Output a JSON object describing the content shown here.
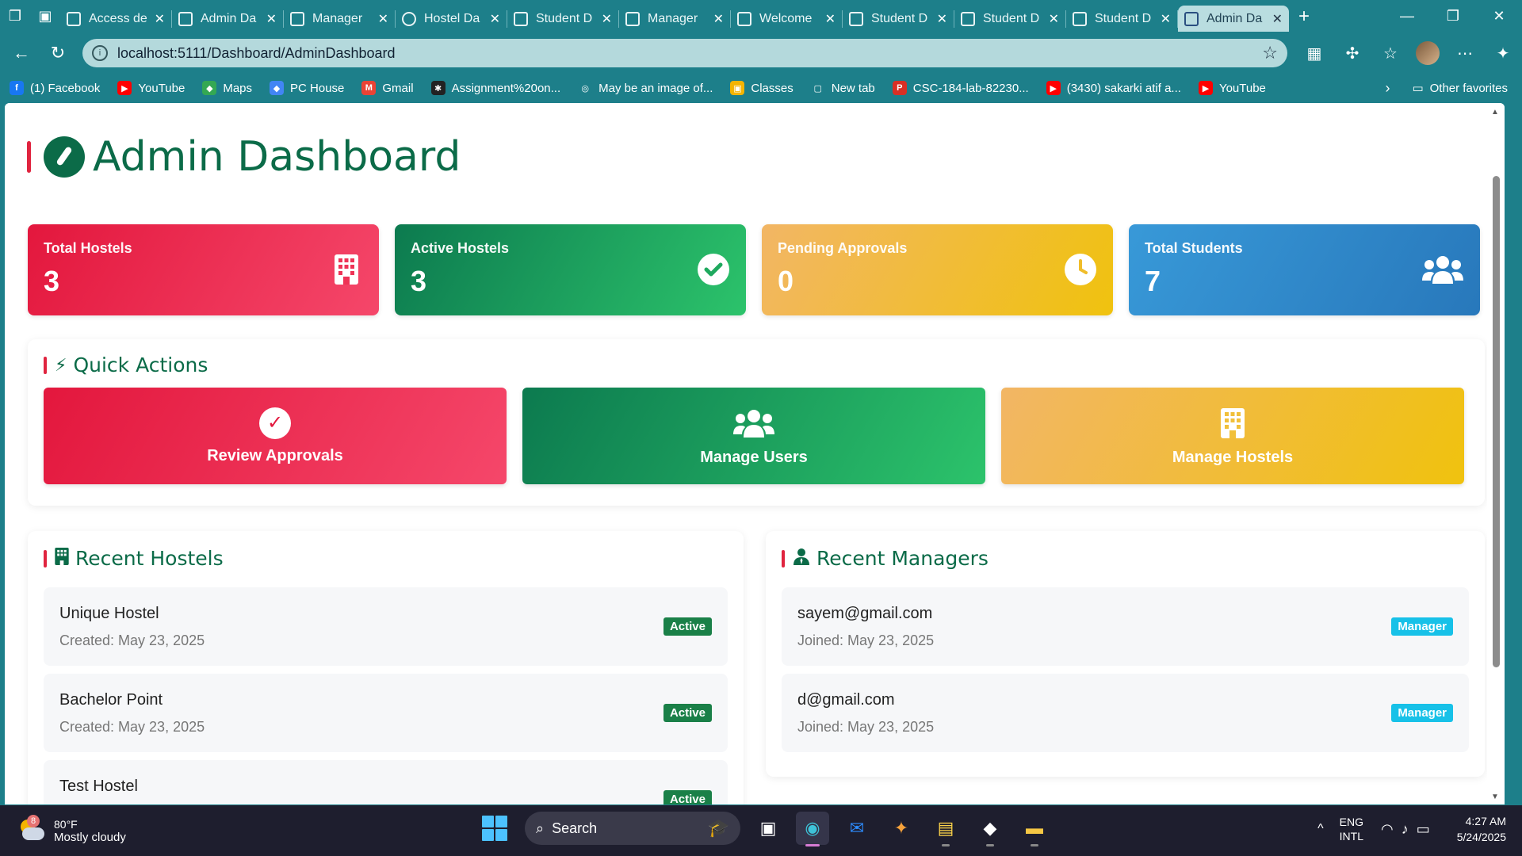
{
  "browser": {
    "tabs": [
      {
        "title": "Access de"
      },
      {
        "title": "Admin Da"
      },
      {
        "title": "Manager"
      },
      {
        "title": "Hostel Da"
      },
      {
        "title": "Student D"
      },
      {
        "title": "Manager"
      },
      {
        "title": "Welcome"
      },
      {
        "title": "Student D"
      },
      {
        "title": "Student D"
      },
      {
        "title": "Student D"
      },
      {
        "title": "Admin Da"
      }
    ],
    "url": "localhost:5111/Dashboard/AdminDashboard",
    "bookmarks": [
      {
        "label": "(1) Facebook",
        "color": "#1877f2",
        "glyph": "f"
      },
      {
        "label": "YouTube",
        "color": "#ff0000",
        "glyph": "▶"
      },
      {
        "label": "Maps",
        "color": "#34a853",
        "glyph": "◆"
      },
      {
        "label": "PC House",
        "color": "#4285f4",
        "glyph": "◆"
      },
      {
        "label": "Gmail",
        "color": "#ea4335",
        "glyph": "M"
      },
      {
        "label": "Assignment%20on...",
        "color": "#222222",
        "glyph": "✱"
      },
      {
        "label": "May be an image of...",
        "color": "#1d7f8a",
        "glyph": "◎"
      },
      {
        "label": "Classes",
        "color": "#f4b400",
        "glyph": "▣"
      },
      {
        "label": "New tab",
        "color": "#1d7f8a",
        "glyph": "▢"
      },
      {
        "label": "CSC-184-lab-82230...",
        "color": "#d93025",
        "glyph": "P"
      },
      {
        "label": "(3430) sakarki atif a...",
        "color": "#ff0000",
        "glyph": "▶"
      },
      {
        "label": "YouTube",
        "color": "#ff0000",
        "glyph": "▶"
      }
    ],
    "other_favorites": "Other favorites"
  },
  "page": {
    "title": "Admin Dashboard",
    "stats": [
      {
        "label": "Total Hostels",
        "value": "3",
        "icon": "building-icon"
      },
      {
        "label": "Active Hostels",
        "value": "3",
        "icon": "check-circle-icon"
      },
      {
        "label": "Pending Approvals",
        "value": "0",
        "icon": "clock-icon"
      },
      {
        "label": "Total Students",
        "value": "7",
        "icon": "users-icon"
      }
    ],
    "quick_actions": {
      "title": "Quick Actions",
      "buttons": [
        {
          "label": "Review Approvals",
          "icon": "check-circle-icon"
        },
        {
          "label": "Manage Users",
          "icon": "users-icon"
        },
        {
          "label": "Manage Hostels",
          "icon": "building-icon"
        }
      ]
    },
    "recent_hostels": {
      "title": "Recent Hostels",
      "items": [
        {
          "name": "Unique Hostel",
          "sub": "Created: May 23, 2025",
          "badge": "Active"
        },
        {
          "name": "Bachelor Point",
          "sub": "Created: May 23, 2025",
          "badge": "Active"
        },
        {
          "name": "Test Hostel",
          "sub": "",
          "badge": "Active"
        }
      ]
    },
    "recent_managers": {
      "title": "Recent Managers",
      "items": [
        {
          "name": "sayem@gmail.com",
          "sub": "Joined: May 23, 2025",
          "badge": "Manager"
        },
        {
          "name": "d@gmail.com",
          "sub": "Joined: May 23, 2025",
          "badge": "Manager"
        }
      ]
    }
  },
  "taskbar": {
    "weather_temp": "80°F",
    "weather_desc": "Mostly cloudy",
    "weather_badge": "8",
    "search_label": "Search",
    "lang_top": "ENG",
    "lang_bottom": "INTL",
    "time": "4:27 AM",
    "date": "5/24/2025"
  }
}
